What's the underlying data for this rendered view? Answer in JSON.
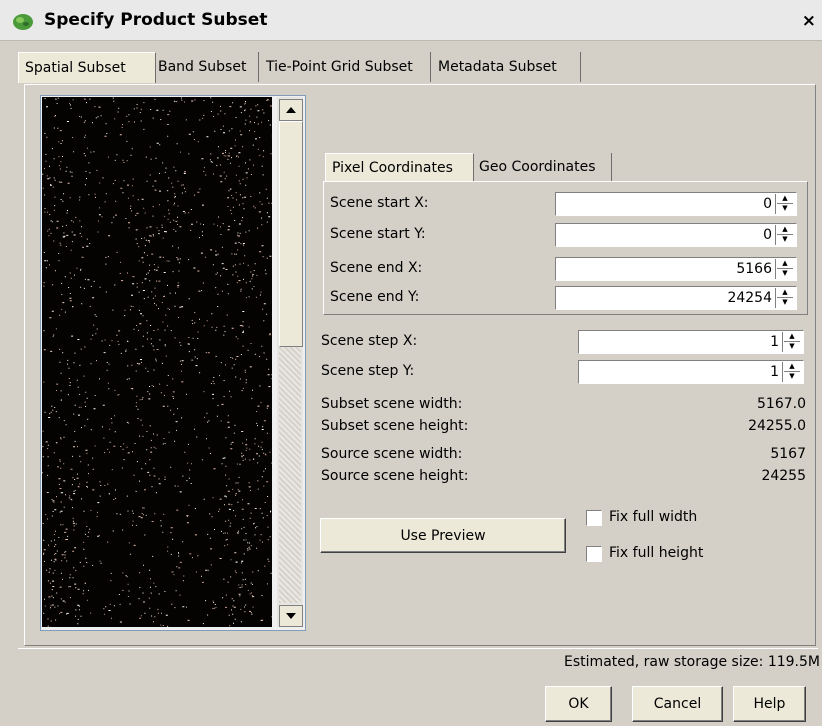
{
  "window": {
    "title": "Specify Product Subset",
    "close_glyph": "×"
  },
  "tabs": [
    {
      "label": "Spatial Subset",
      "active": true
    },
    {
      "label": "Band Subset",
      "active": false
    },
    {
      "label": "Tie-Point Grid Subset",
      "active": false
    },
    {
      "label": "Metadata Subset",
      "active": false
    }
  ],
  "coordinate_tabs": [
    {
      "label": "Pixel Coordinates",
      "active": true
    },
    {
      "label": "Geo Coordinates",
      "active": false
    }
  ],
  "pixel_coordinates": {
    "scene_start_x": {
      "label": "Scene start X:",
      "value": "0"
    },
    "scene_start_y": {
      "label": "Scene start Y:",
      "value": "0"
    },
    "scene_end_x": {
      "label": "Scene end X:",
      "value": "5166"
    },
    "scene_end_y": {
      "label": "Scene end Y:",
      "value": "24254"
    }
  },
  "step": {
    "scene_step_x": {
      "label": "Scene step X:",
      "value": "1"
    },
    "scene_step_y": {
      "label": "Scene step Y:",
      "value": "1"
    }
  },
  "info": [
    {
      "label": "Subset scene width:",
      "value": "5167.0"
    },
    {
      "label": "Subset scene height:",
      "value": "24255.0"
    },
    {
      "label": "Source scene width:",
      "value": "5167"
    },
    {
      "label": "Source scene height:",
      "value": "24255"
    }
  ],
  "buttons": {
    "use_preview": "Use Preview",
    "ok": "OK",
    "cancel": "Cancel",
    "help": "Help"
  },
  "checkboxes": {
    "fix_full_width": {
      "label": "Fix full width",
      "checked": false
    },
    "fix_full_height": {
      "label": "Fix full height",
      "checked": false
    }
  },
  "status": {
    "estimated_storage": "Estimated, raw storage size: 119.5M"
  },
  "icons": {
    "app": "app-logo-icon",
    "scroll_up": "arrow-up-icon",
    "scroll_down": "arrow-down-icon",
    "spin_up": "spin-up-icon",
    "spin_down": "spin-down-icon"
  },
  "colors": {
    "dialog_bg": "#d4d0c8",
    "title_bg": "#e9e9ea",
    "preview_bg": "#050302",
    "field_bg": "#ffffff"
  }
}
